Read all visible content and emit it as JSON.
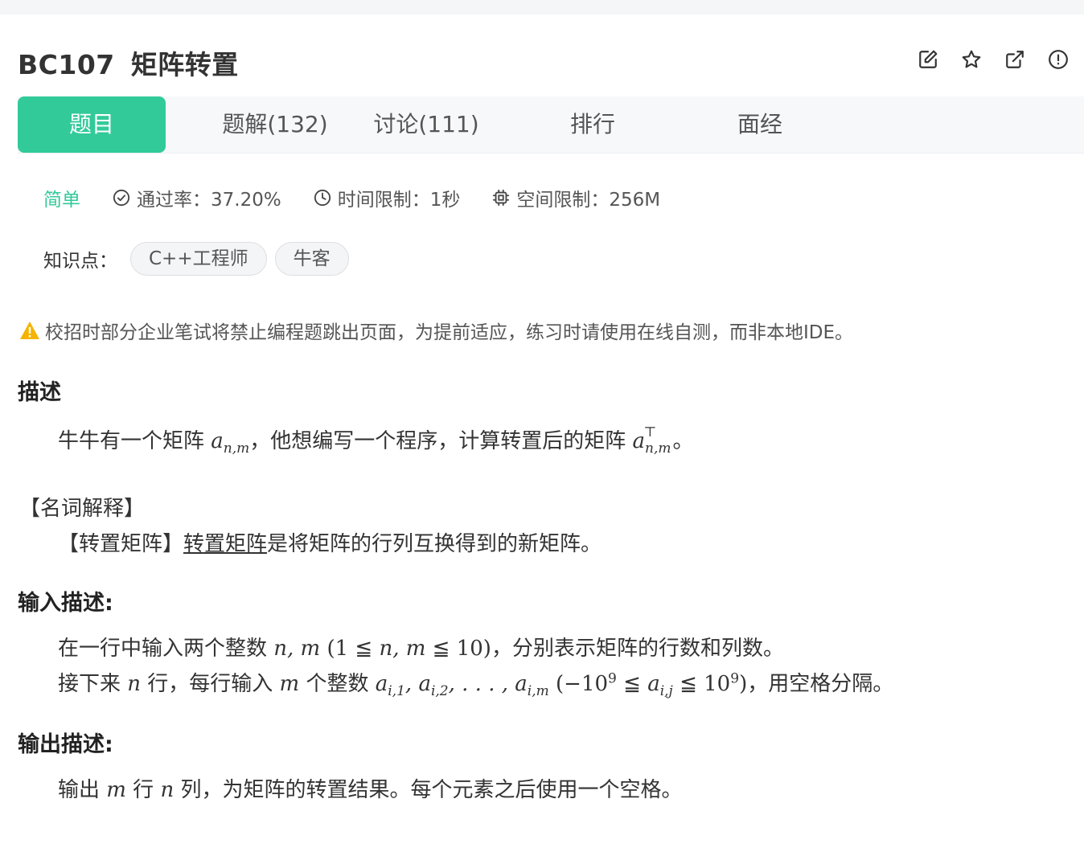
{
  "problem": {
    "code": "BC107",
    "title": "矩阵转置"
  },
  "header_icons": [
    "edit-icon",
    "star-icon",
    "share-icon",
    "report-icon"
  ],
  "tabs": [
    {
      "label": "题目",
      "active": true
    },
    {
      "label": "题解(132)",
      "active": false
    },
    {
      "label": "讨论(111)",
      "active": false
    },
    {
      "label": "排行",
      "active": false
    },
    {
      "label": "面经",
      "active": false
    }
  ],
  "meta": {
    "difficulty": "简单",
    "pass_rate": "通过率：37.20%",
    "time_limit": "时间限制：1秒",
    "space_limit": "空间限制：256M"
  },
  "knowledge": {
    "label": "知识点：",
    "tags": [
      "C++工程师",
      "牛客"
    ]
  },
  "warning": "校招时部分企业笔试将禁止编程题跳出页面，为提前适应，练习时请使用在线自测，而非本地IDE。",
  "description": {
    "heading": "描述",
    "text1": "牛牛有一个矩阵 ",
    "text2": "，他想编写一个程序，计算转置后的矩阵 ",
    "text3": "。"
  },
  "glossary": {
    "heading": "【名词解释】",
    "term": "【转置矩阵】",
    "link": "转置矩阵",
    "definition": "是将矩阵的行列互换得到的新矩阵。"
  },
  "input": {
    "heading": "输入描述:",
    "line1_a": "在一行中输入两个整数 ",
    "line1_b": "，分别表示矩阵的行数和列数。",
    "line2_a": "接下来 ",
    "line2_b": " 行，每行输入 ",
    "line2_c": " 个整数 ",
    "line2_d": "，用空格分隔。"
  },
  "output": {
    "heading": "输出描述:",
    "a": "输出 ",
    "b": " 行 ",
    "c": " 列，为矩阵的转置结果。每个元素之后使用一个空格。"
  },
  "colors": {
    "accent": "#32ca99",
    "warning": "#f5b400"
  }
}
